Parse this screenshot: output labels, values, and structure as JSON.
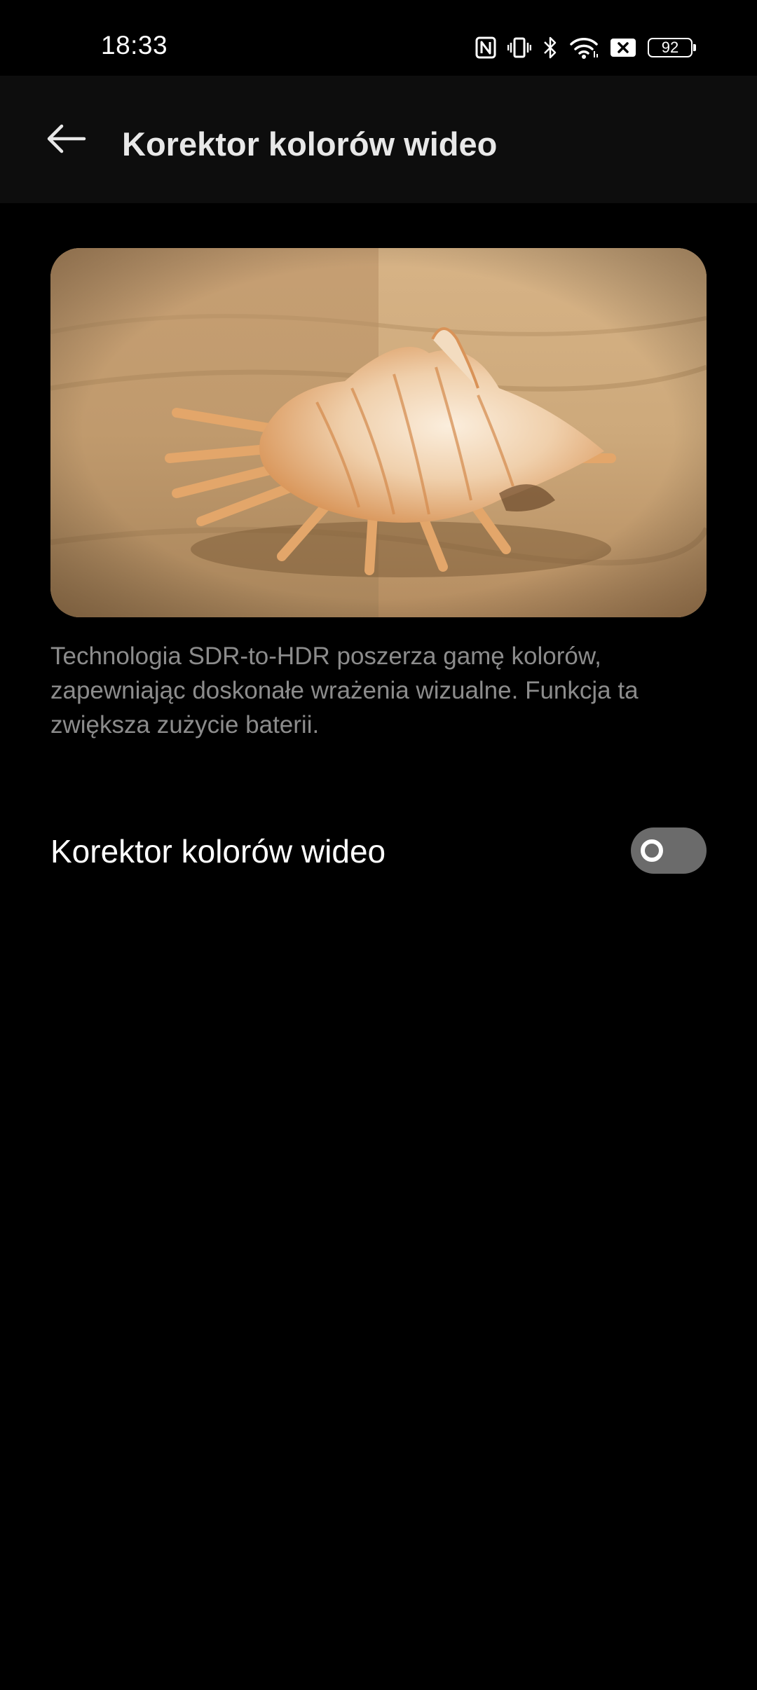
{
  "status_bar": {
    "time": "18:33",
    "battery": "92",
    "icons": [
      "nfc-icon",
      "vibrate-icon",
      "bluetooth-icon",
      "wifi-icon",
      "sim-off-icon",
      "battery-icon"
    ]
  },
  "app_bar": {
    "back_icon": "arrow-left-icon",
    "title": "Korektor kolorów wideo"
  },
  "preview": {
    "image": "seashell-on-sand-comparison"
  },
  "description": "Technologia SDR-to-HDR poszerza gamę kolorów, zapewniając doskonałe wrażenia wizualne. Funkcja ta zwiększa zużycie baterii.",
  "settings": {
    "toggle_label": "Korektor kolorów wideo",
    "toggle_state": "off"
  },
  "colors": {
    "background": "#000000",
    "app_bar": "#0d0d0d",
    "secondary_text": "#8c8c8c",
    "switch_off": "#6b6b6b"
  }
}
